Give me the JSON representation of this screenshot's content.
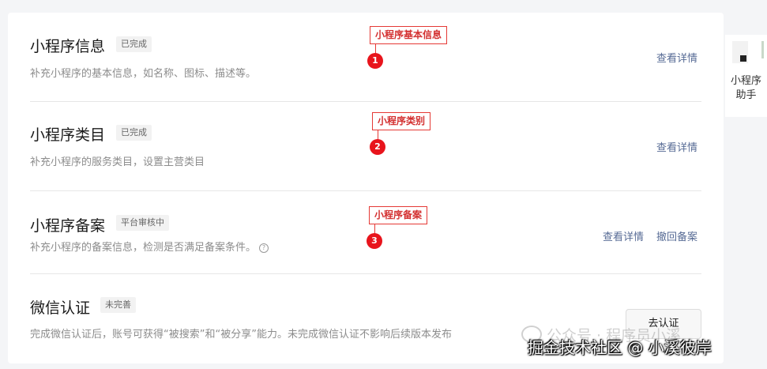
{
  "sections": [
    {
      "title": "小程序信息",
      "badge": "已完成",
      "desc": "补充小程序的基本信息，如名称、图标、描述等。",
      "actions": [
        "查看详情"
      ],
      "callout": "小程序基本信息",
      "marker": "1"
    },
    {
      "title": "小程序类目",
      "badge": "已完成",
      "desc": "补充小程序的服务类目，设置主营类目",
      "actions": [
        "查看详情"
      ],
      "callout": "小程序类别",
      "marker": "2"
    },
    {
      "title": "小程序备案",
      "badge": "平台审核中",
      "desc": "补充小程序的备案信息，检测是否满足备案条件。",
      "actions": [
        "查看详情",
        "撤回备案"
      ],
      "callout": "小程序备案",
      "marker": "3",
      "help": "?"
    },
    {
      "title": "微信认证",
      "badge": "未完善",
      "desc": "完成微信认证后，账号可获得“被搜索”和“被分享”能力。未完成微信认证不影响后续版本发布",
      "button": "去认证"
    }
  ],
  "assistant": {
    "line1": "小程序",
    "line2": "助手"
  },
  "watermark": {
    "top": "公众号 · 程序员小溪",
    "bottom": "掘金技术社区 @ 小溪彼岸"
  },
  "colors": {
    "link": "#576b95",
    "callout": "#e53935",
    "marker": "#e8141c"
  }
}
